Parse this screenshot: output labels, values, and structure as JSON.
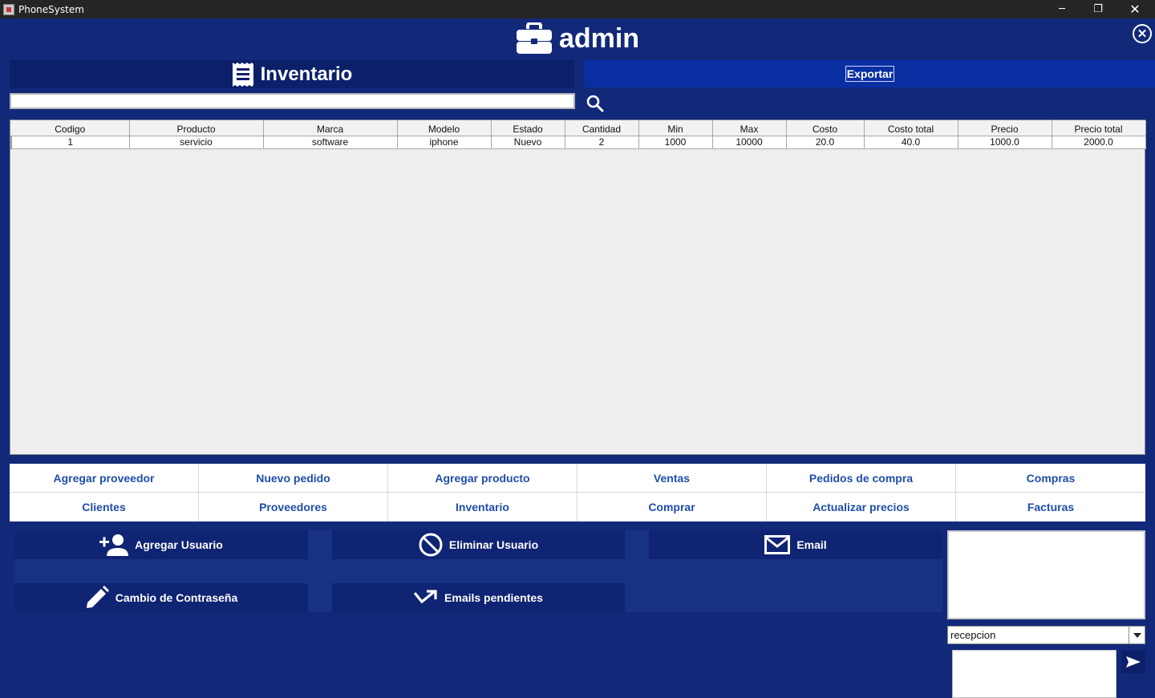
{
  "window": {
    "title": "PhoneSystem",
    "minimize_glyph": "─",
    "maximize_glyph": "❐",
    "close_glyph": "✕"
  },
  "header": {
    "user": "admin",
    "icon": "briefcase-icon",
    "close_glyph": "✕"
  },
  "inventory_bar": {
    "label": "Inventario",
    "icon": "receipt-icon"
  },
  "export_label": "Exportar",
  "search": {
    "value": "",
    "placeholder": ""
  },
  "table": {
    "columns": [
      "Codigo",
      "Producto",
      "Marca",
      "Modelo",
      "Estado",
      "Cantidad",
      "Min",
      "Max",
      "Costo",
      "Costo total",
      "Precio",
      "Precio total"
    ],
    "rows": [
      [
        "1",
        "servicio",
        "software",
        "iphone",
        "Nuevo",
        "2",
        "1000",
        "10000",
        "20.0",
        "40.0",
        "1000.0",
        "2000.0"
      ]
    ]
  },
  "nav": {
    "row1": [
      "Agregar proveedor",
      "Nuevo pedido",
      "Agregar producto",
      "Ventas",
      "Pedidos de compra",
      "Compras"
    ],
    "row2": [
      "Clientes",
      "Proveedores",
      "Inventario",
      "Comprar",
      "Actualizar precios",
      "Facturas"
    ]
  },
  "actions": {
    "add_user": "Agregar Usuario",
    "delete_user": "Eliminar Usuario",
    "email": "Email",
    "change_password": "Cambio de Contraseña",
    "pending_emails": "Emails pendientes"
  },
  "chat": {
    "recipient": "recepcion",
    "message_value": ""
  },
  "colors": {
    "background": "#12297a",
    "dark_panel": "#0c206a",
    "export": "#0a2fa2",
    "nav_text": "#1f4ea8",
    "titlebar": "#252526"
  }
}
